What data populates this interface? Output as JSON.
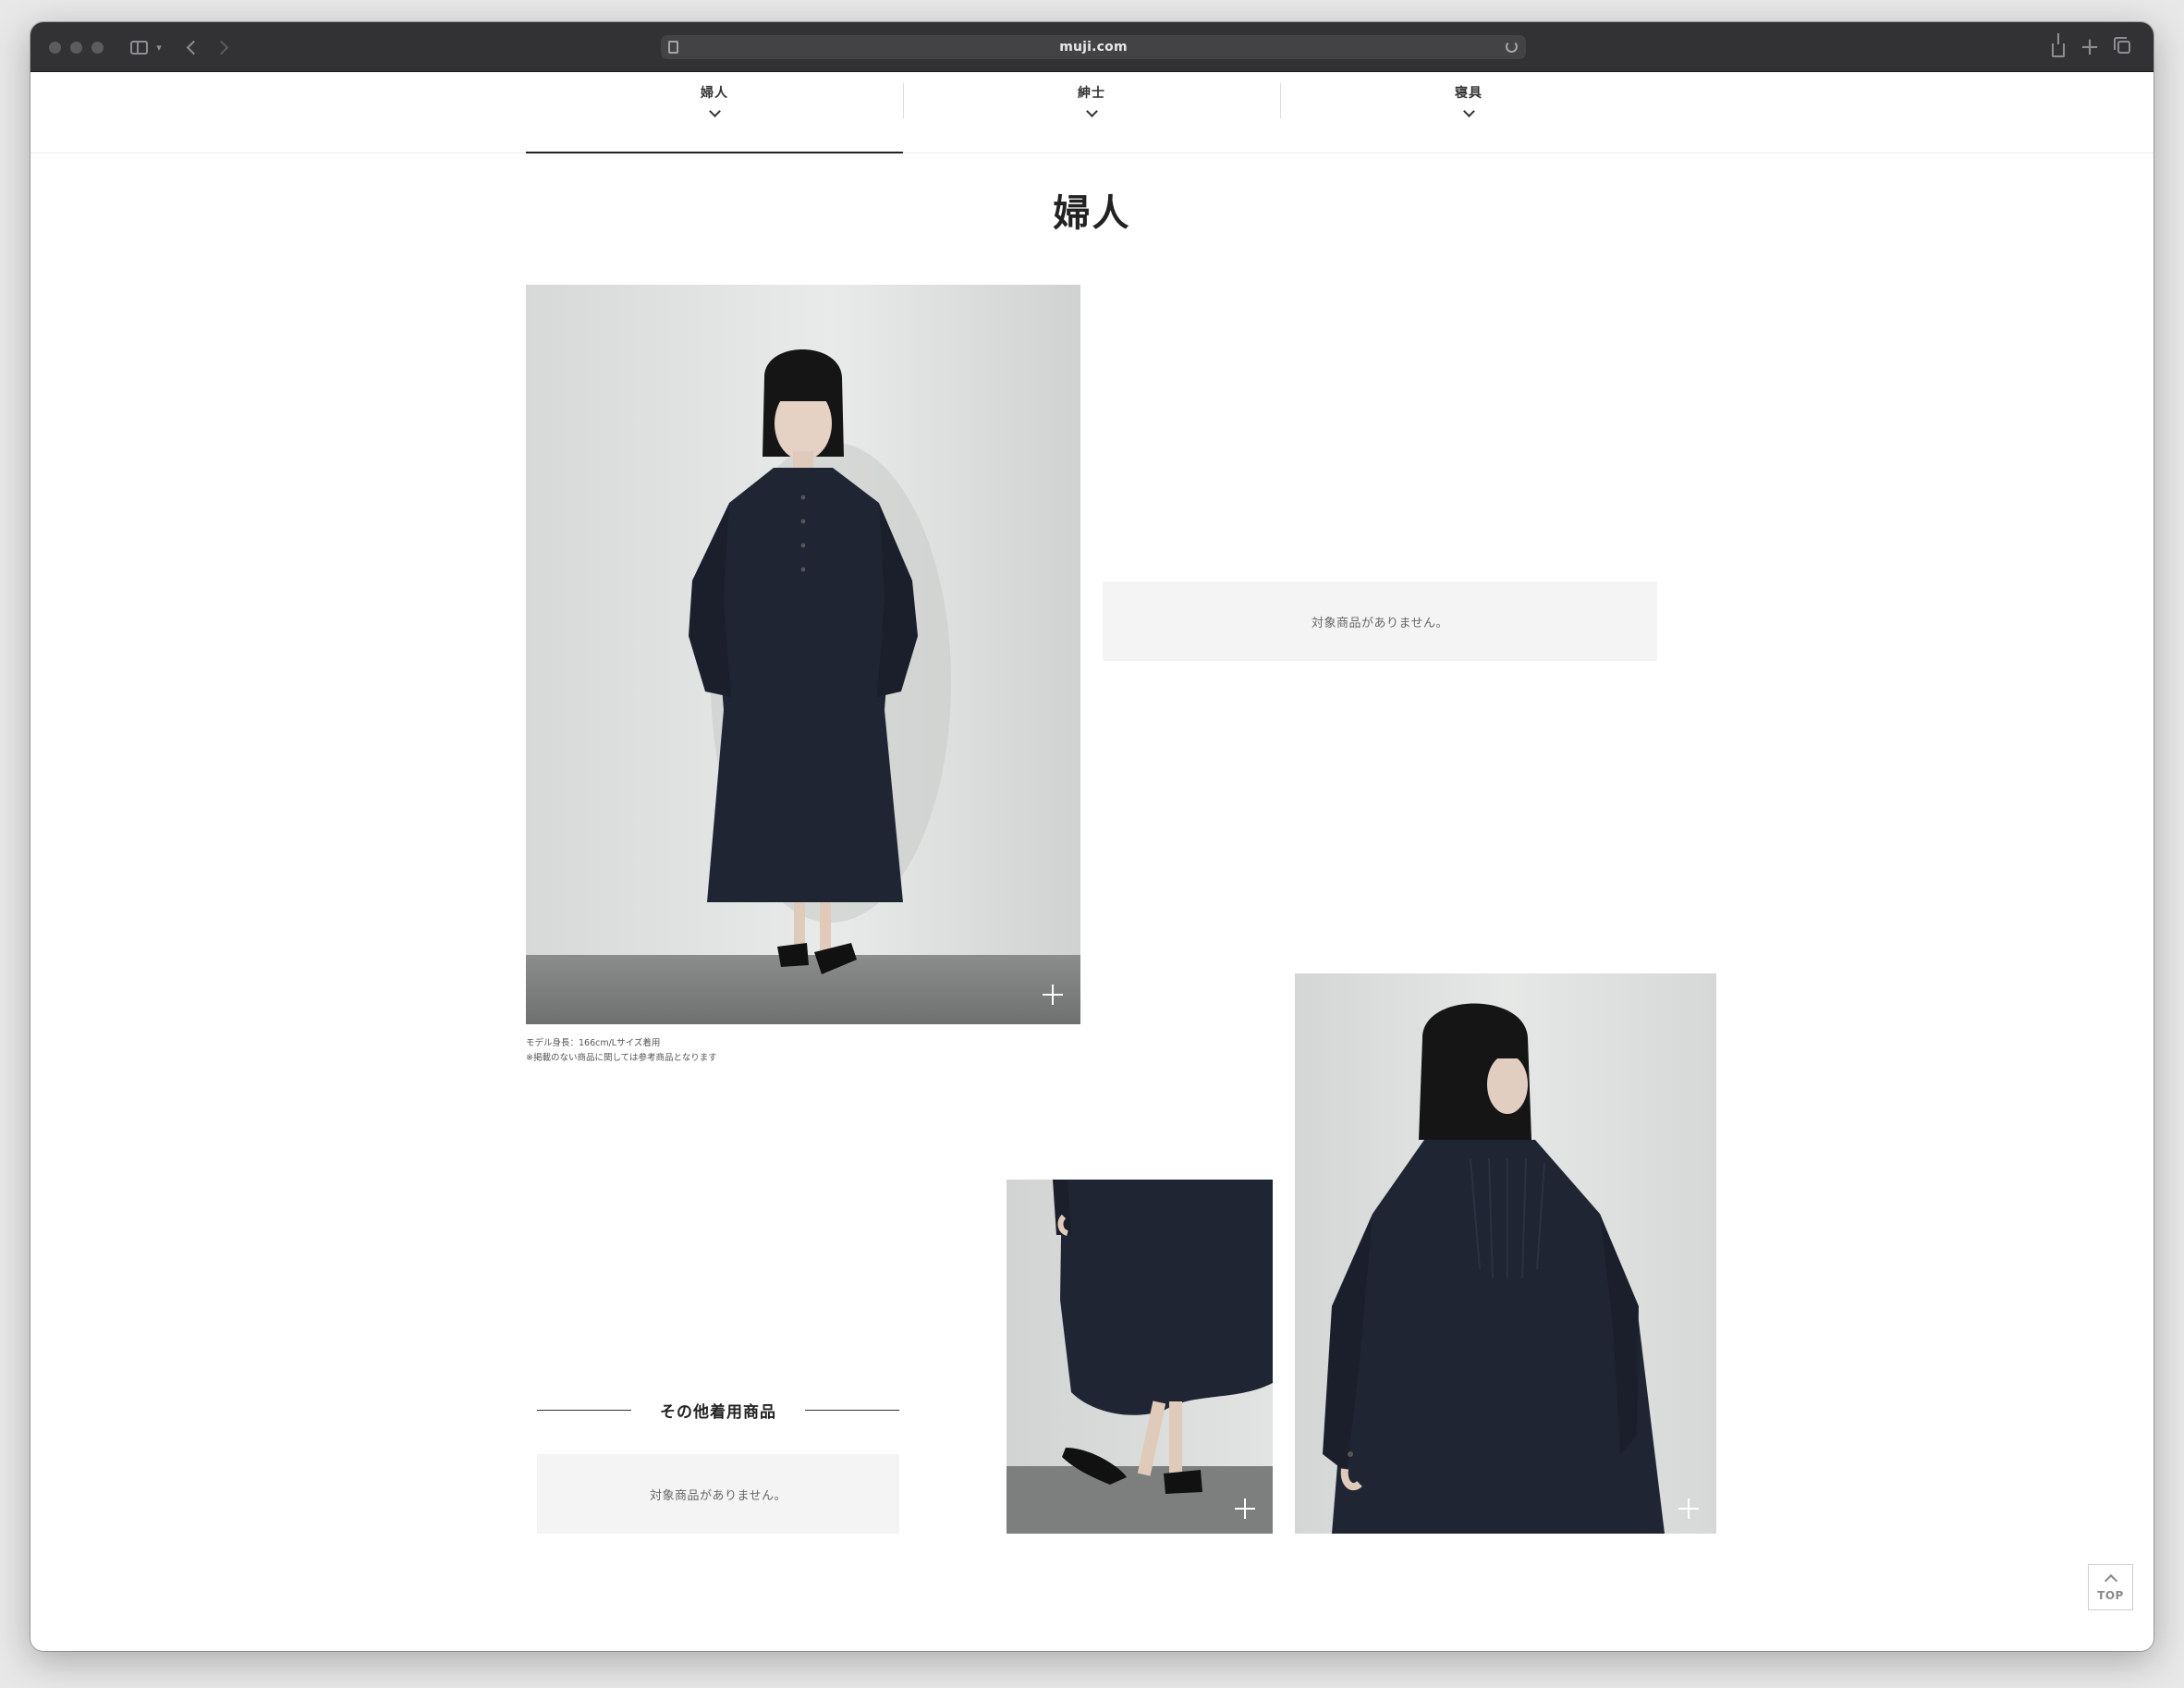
{
  "browser": {
    "url": "muji.com"
  },
  "category_tabs": [
    {
      "label": "婦人"
    },
    {
      "label": "紳士"
    },
    {
      "label": "寝具"
    }
  ],
  "page": {
    "title": "婦人"
  },
  "main_photo": {
    "caption_line1": "モデル身長：166cm/Lサイズ着用",
    "caption_line2": "※掲載のない商品に関しては参考商品となります"
  },
  "empty_message_main": "対象商品がありません。",
  "other_items": {
    "heading": "その他着用商品",
    "empty_message": "対象商品がありません。"
  },
  "top_button": {
    "label": "TOP"
  },
  "icons": [
    "sidebar-icon",
    "back-icon",
    "forward-icon",
    "page-icon",
    "reload-icon",
    "share-icon",
    "new-tab-icon",
    "tabs-overview-icon",
    "chevron-down-icon",
    "plus-icon",
    "arrow-up-icon"
  ],
  "colors": {
    "chrome_bg": "#323235",
    "address_bg": "#434346",
    "empty_box_bg": "#f4f4f4",
    "text_dark": "#222222",
    "garment_navy": "#1f2533"
  }
}
